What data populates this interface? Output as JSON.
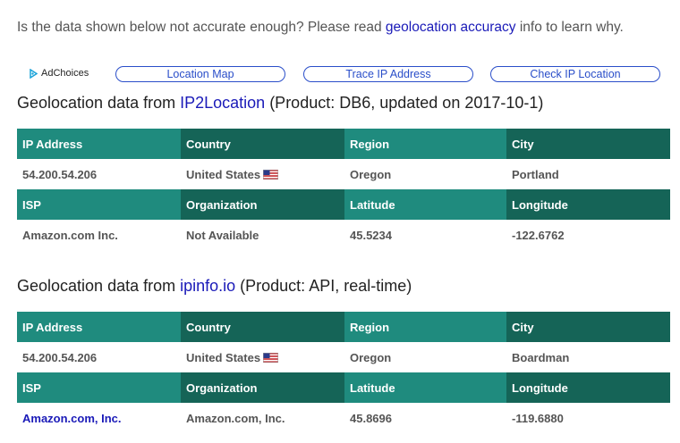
{
  "notice": {
    "before": "Is the data shown below not accurate enough? Please read ",
    "link": "geolocation accuracy",
    "after": " info to learn why."
  },
  "adchoices": {
    "label": "AdChoices",
    "icon": "adchoices-icon"
  },
  "buttons": {
    "location_map": "Location Map",
    "trace_ip": "Trace IP Address",
    "check_ip": "Check IP Location"
  },
  "sections": [
    {
      "title_before": "Geolocation data from ",
      "provider": "IP2Location",
      "title_after": " (Product: DB6, updated on 2017-10-1)",
      "headers1": [
        "IP Address",
        "Country",
        "Region",
        "City"
      ],
      "values1": [
        "54.200.54.206",
        "United States",
        "Oregon",
        "Portland"
      ],
      "headers2": [
        "ISP",
        "Organization",
        "Latitude",
        "Longitude"
      ],
      "values2": [
        "Amazon.com Inc.",
        "Not Available",
        "45.5234",
        "-122.6762"
      ]
    },
    {
      "title_before": "Geolocation data from ",
      "provider": "ipinfo.io",
      "title_after": " (Product: API, real-time)",
      "headers1": [
        "IP Address",
        "Country",
        "Region",
        "City"
      ],
      "values1": [
        "54.200.54.206",
        "United States",
        "Oregon",
        "Boardman"
      ],
      "headers2": [
        "ISP",
        "Organization",
        "Latitude",
        "Longitude"
      ],
      "values2": [
        "Amazon.com, Inc.",
        "Amazon.com, Inc.",
        "45.8696",
        "-119.6880"
      ]
    }
  ],
  "colors": {
    "header_teal": "#1f8b7e",
    "header_dark_teal": "#156457",
    "link_blue": "#1a1ab8",
    "button_blue": "#2a4ec9"
  }
}
